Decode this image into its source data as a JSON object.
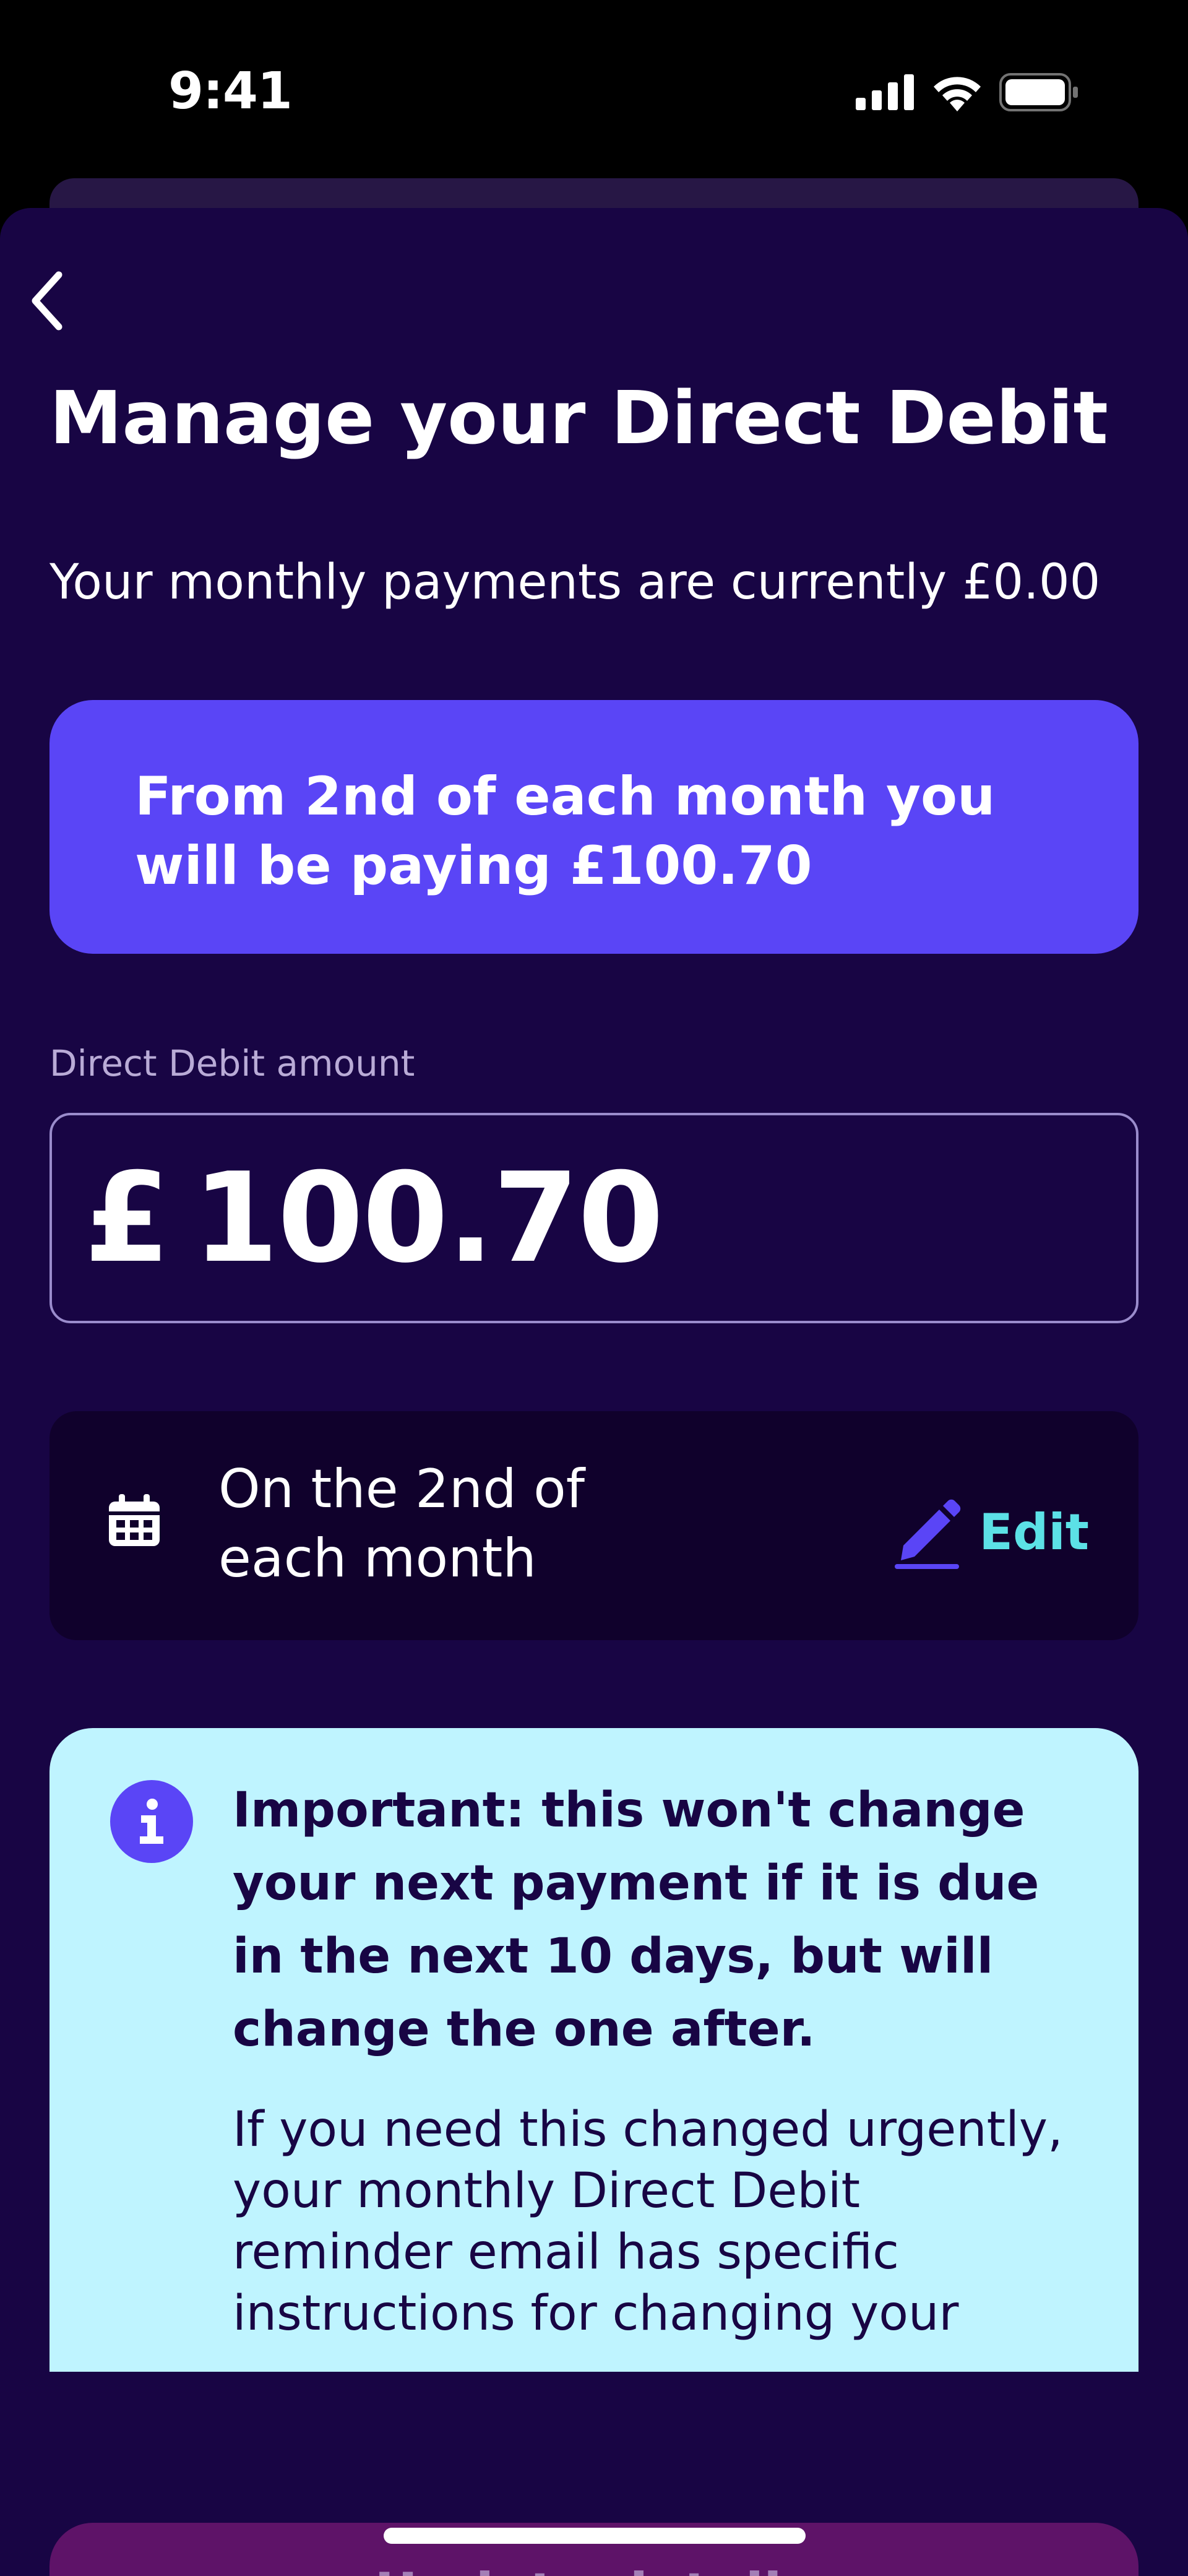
{
  "status_bar": {
    "time": "9:41",
    "icons": [
      "signal-icon",
      "wifi-icon",
      "battery-icon"
    ]
  },
  "nav": {
    "back_icon": "chevron-left-icon"
  },
  "page": {
    "title": "Manage your Direct Debit",
    "current_payment": "Your monthly payments are currently £0.00",
    "new_payment_banner": "From 2nd of each month you will be paying £100.70"
  },
  "amount": {
    "label": "Direct Debit amount",
    "currency": "£",
    "value": "100.70"
  },
  "schedule": {
    "icon": "calendar-icon",
    "text": "On the 2nd of each month",
    "edit_icon": "pencil-icon",
    "edit_label": "Edit"
  },
  "info": {
    "icon": "info-icon",
    "heading": "Important: this won't change your next payment if it is due in the next 10 days, but will change the one after.",
    "body": "If you need this changed urgently, your monthly Direct Debit reminder email has specific instructions for changing your"
  },
  "footer": {
    "update_label": "Update details"
  },
  "colors": {
    "background": "#180544",
    "accent": "#5a45f6",
    "info_background": "#bff4ff",
    "edit_accent": "#5ce1e6",
    "button_disabled": "#5e1368"
  }
}
